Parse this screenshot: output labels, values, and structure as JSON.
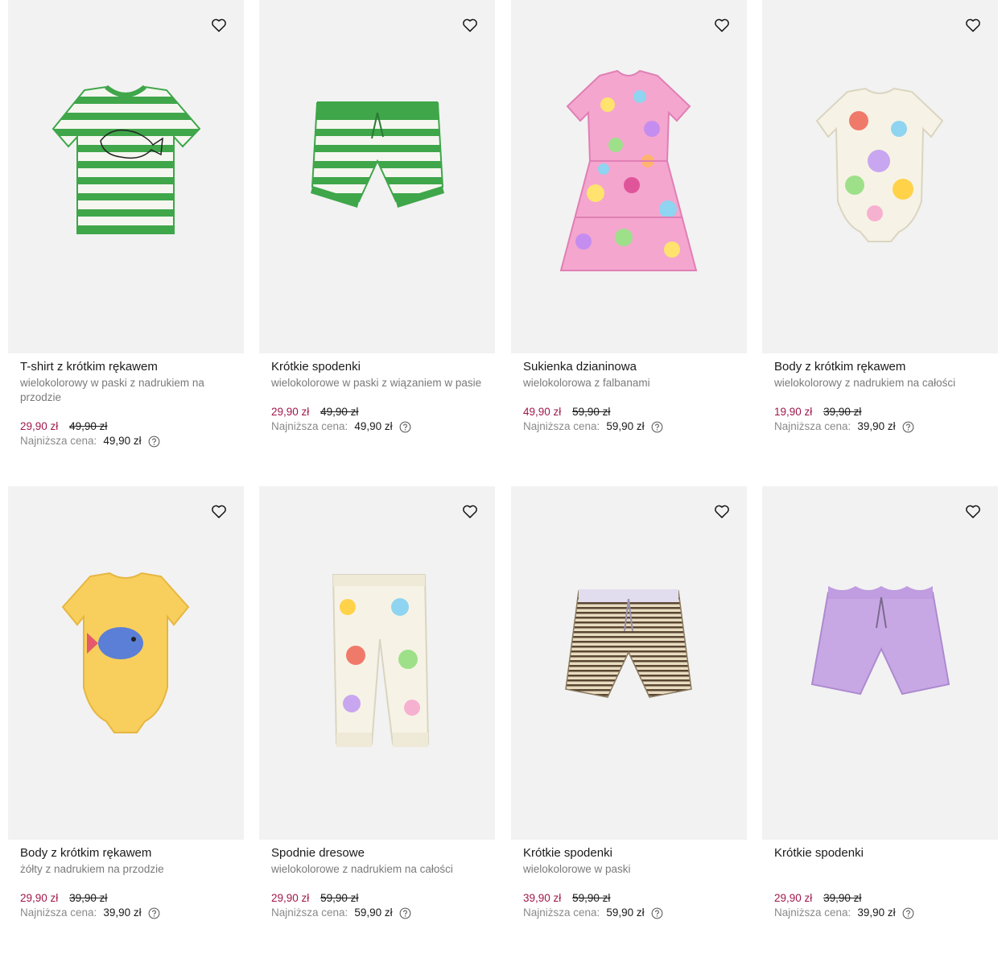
{
  "colors": {
    "sale": "#a0184a",
    "muted": "#7a7a7a",
    "image_bg": "#f2f2f2"
  },
  "icons": {
    "favorite": "heart-icon",
    "info": "question-circle-icon"
  },
  "products": [
    {
      "name": "T-shirt z krótkim rękawem",
      "desc": "wielokolorowy w paski z nadrukiem na przodzie",
      "price_now": "29,90 zł",
      "price_old": "49,90 zł",
      "lowest_label": "Najniższa cena:",
      "lowest_value": "49,90 zł"
    },
    {
      "name": "Krótkie spodenki",
      "desc": "wielokolorowe w paski z wiązaniem w pasie",
      "price_now": "29,90 zł",
      "price_old": "49,90 zł",
      "lowest_label": "Najniższa cena:",
      "lowest_value": "49,90 zł"
    },
    {
      "name": "Sukienka dzianinowa",
      "desc": "wielokolorowa z falbanami",
      "price_now": "49,90 zł",
      "price_old": "59,90 zł",
      "lowest_label": "Najniższa cena:",
      "lowest_value": "59,90 zł"
    },
    {
      "name": "Body z krótkim rękawem",
      "desc": "wielokolorowy z nadrukiem na całości",
      "price_now": "19,90 zł",
      "price_old": "39,90 zł",
      "lowest_label": "Najniższa cena:",
      "lowest_value": "39,90 zł"
    },
    {
      "name": "Body z krótkim rękawem",
      "desc": "żółty z nadrukiem na przodzie",
      "price_now": "29,90 zł",
      "price_old": "39,90 zł",
      "lowest_label": "Najniższa cena:",
      "lowest_value": "39,90 zł"
    },
    {
      "name": "Spodnie dresowe",
      "desc": "wielokolorowe z nadrukiem na całości",
      "price_now": "29,90 zł",
      "price_old": "59,90 zł",
      "lowest_label": "Najniższa cena:",
      "lowest_value": "59,90 zł"
    },
    {
      "name": "Krótkie spodenki",
      "desc": "wielokolorowe w paski",
      "price_now": "39,90 zł",
      "price_old": "59,90 zł",
      "lowest_label": "Najniższa cena:",
      "lowest_value": "59,90 zł"
    },
    {
      "name": "Krótkie spodenki",
      "desc": "",
      "price_now": "29,90 zł",
      "price_old": "39,90 zł",
      "lowest_label": "Najniższa cena:",
      "lowest_value": "39,90 zł"
    }
  ]
}
